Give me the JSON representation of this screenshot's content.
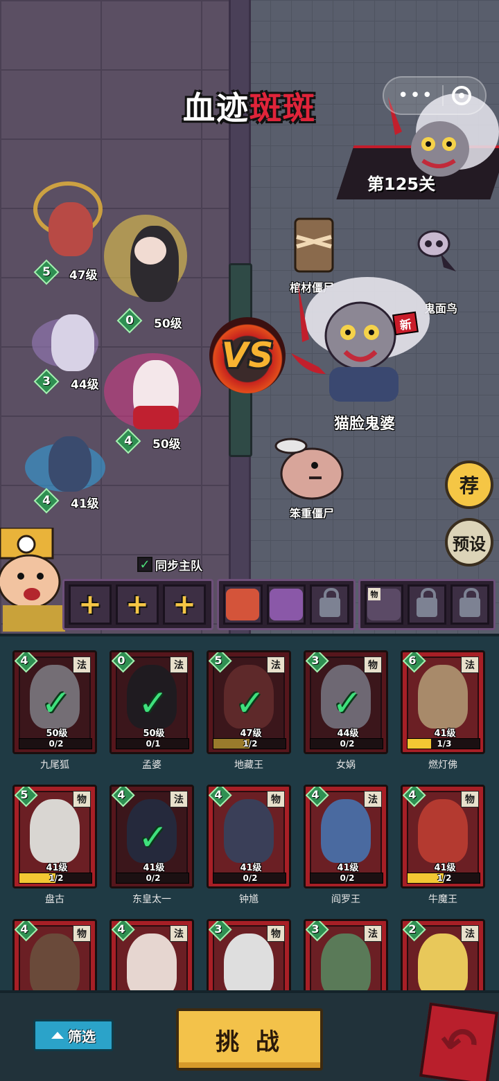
{
  "stage": {
    "title_white": "血迹",
    "title_red": "斑斑",
    "level": "第125关"
  },
  "vs": "VS",
  "heroes": [
    {
      "name": "地藏王",
      "stars": "5",
      "level": "47级"
    },
    {
      "name": "孟婆",
      "stars": "0",
      "level": "50级"
    },
    {
      "name": "女娲",
      "stars": "3",
      "level": "44级"
    },
    {
      "name": "九尾狐",
      "stars": "4",
      "level": "50级"
    },
    {
      "name": "东皇太一",
      "stars": "4",
      "level": "41级"
    }
  ],
  "enemies": [
    {
      "name": "棺材僵尸"
    },
    {
      "name": "鬼面鸟"
    },
    {
      "name": "猫脸鬼婆",
      "tag": "新"
    },
    {
      "name": "笨重僵尸"
    }
  ],
  "side_buttons": {
    "recommend": "荐",
    "preset": "预设"
  },
  "sync": {
    "checked": true,
    "label": "同步主队",
    "check_glyph": "✓"
  },
  "slots": {
    "add_glyph": "+",
    "type_phys": "物"
  },
  "roster": [
    {
      "name": "九尾狐",
      "stars": "4",
      "type": "法",
      "level": "50级",
      "progress": "0/2",
      "fill": 0,
      "selected": true
    },
    {
      "name": "孟婆",
      "stars": "0",
      "type": "法",
      "level": "50级",
      "progress": "0/1",
      "fill": 0,
      "selected": true
    },
    {
      "name": "地藏王",
      "stars": "5",
      "type": "法",
      "level": "47级",
      "progress": "1/2",
      "fill": 0.5,
      "selected": true
    },
    {
      "name": "女娲",
      "stars": "3",
      "type": "物",
      "level": "44级",
      "progress": "0/2",
      "fill": 0,
      "selected": true
    },
    {
      "name": "燃灯佛",
      "stars": "6",
      "type": "法",
      "level": "41级",
      "progress": "1/3",
      "fill": 0.33,
      "selected": false
    },
    {
      "name": "盘古",
      "stars": "5",
      "type": "物",
      "level": "41级",
      "progress": "1/2",
      "fill": 0.5,
      "selected": false
    },
    {
      "name": "东皇太一",
      "stars": "4",
      "type": "法",
      "level": "41级",
      "progress": "0/2",
      "fill": 0,
      "selected": true
    },
    {
      "name": "钟馗",
      "stars": "4",
      "type": "物",
      "level": "41级",
      "progress": "0/2",
      "fill": 0,
      "selected": false
    },
    {
      "name": "阎罗王",
      "stars": "4",
      "type": "法",
      "level": "41级",
      "progress": "0/2",
      "fill": 0,
      "selected": false
    },
    {
      "name": "牛魔王",
      "stars": "4",
      "type": "物",
      "level": "41级",
      "progress": "1/2",
      "fill": 0.5,
      "selected": false
    },
    {
      "name": "",
      "stars": "4",
      "type": "物",
      "level": "",
      "progress": "",
      "fill": 0,
      "selected": false
    },
    {
      "name": "",
      "stars": "4",
      "type": "法",
      "level": "",
      "progress": "",
      "fill": 0,
      "selected": false
    },
    {
      "name": "",
      "stars": "3",
      "type": "物",
      "level": "",
      "progress": "",
      "fill": 0,
      "selected": false
    },
    {
      "name": "",
      "stars": "3",
      "type": "法",
      "level": "",
      "progress": "",
      "fill": 0,
      "selected": false
    },
    {
      "name": "",
      "stars": "2",
      "type": "法",
      "level": "",
      "progress": "",
      "fill": 0,
      "selected": false
    }
  ],
  "bottom": {
    "filter": "筛选",
    "challenge": "挑 战"
  },
  "colors": {
    "gold": "#f3c24a",
    "card_red": "#a71f26",
    "star_green": "#2f8f52"
  }
}
